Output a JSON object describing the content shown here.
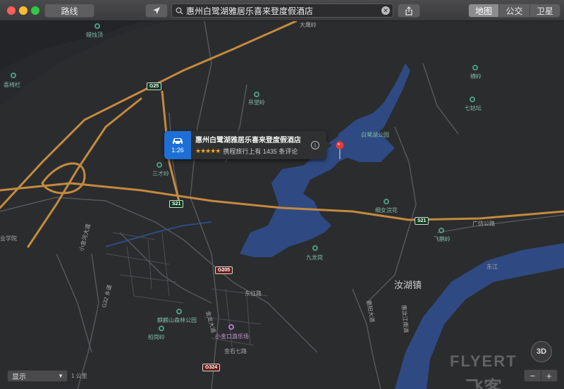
{
  "toolbar": {
    "route_label": "路线",
    "search_value": "惠州白鹭湖雅居乐喜来登度假酒店",
    "map_types": [
      {
        "label": "地图",
        "active": true
      },
      {
        "label": "公交",
        "active": false
      },
      {
        "label": "卫星",
        "active": false
      }
    ]
  },
  "callout": {
    "title": "惠州白鹭湖雅居乐喜来登度假酒店",
    "drive_time": "1:26",
    "stars": "★★★★★",
    "reviews": "携程旅行上有 1435 条评论"
  },
  "map": {
    "labels": {
      "labazhu": "蜡烛顶",
      "damoling": "大鹰岭",
      "xiyilan": "喜椅栏",
      "diaowangling": "吊望岭",
      "henglin": "横岭",
      "qiguotan": "七姑坛",
      "bailuhu_park": "白鹭湖公园",
      "sancailing": "三才岭",
      "xinvhuanhua": "细女浣花",
      "guangfang_road": "广仿公路",
      "feipengling": "飞鹏岭",
      "jiulonggang": "九龙岗",
      "ruhu_town": "汝湖镇",
      "dongzheng_road": "东征路",
      "qilin_park": "麒麟山森林公园",
      "baigangling": "柏岗岭",
      "xiaojinkou_park": "小金口游乐场",
      "jinshi_road": "金石七路",
      "xiaojinhe": "小金河大道",
      "xueyuan": "业学院",
      "dongjiang": "东江",
      "jinlong": "金龙大道",
      "huidong": "惠阳大道",
      "jiangdong": "惠汝江南道",
      "g25": "G25",
      "s21a": "S21",
      "s21b": "S21",
      "g205": "G205",
      "g324": "G324",
      "g32": "G32 乡道"
    }
  },
  "controls": {
    "display_label": "显示",
    "btn_3d": "3D",
    "zoom_out": "−",
    "zoom_in": "+",
    "scale": "1 公里"
  },
  "watermark": {
    "line1": "FLYERT",
    "line2": "飞客"
  },
  "colors": {
    "water": "#2f4a82",
    "highway": "#c48a3e",
    "road": "#5c5d60",
    "accent": "#1d6fd6",
    "pin": "#e23b3b"
  }
}
